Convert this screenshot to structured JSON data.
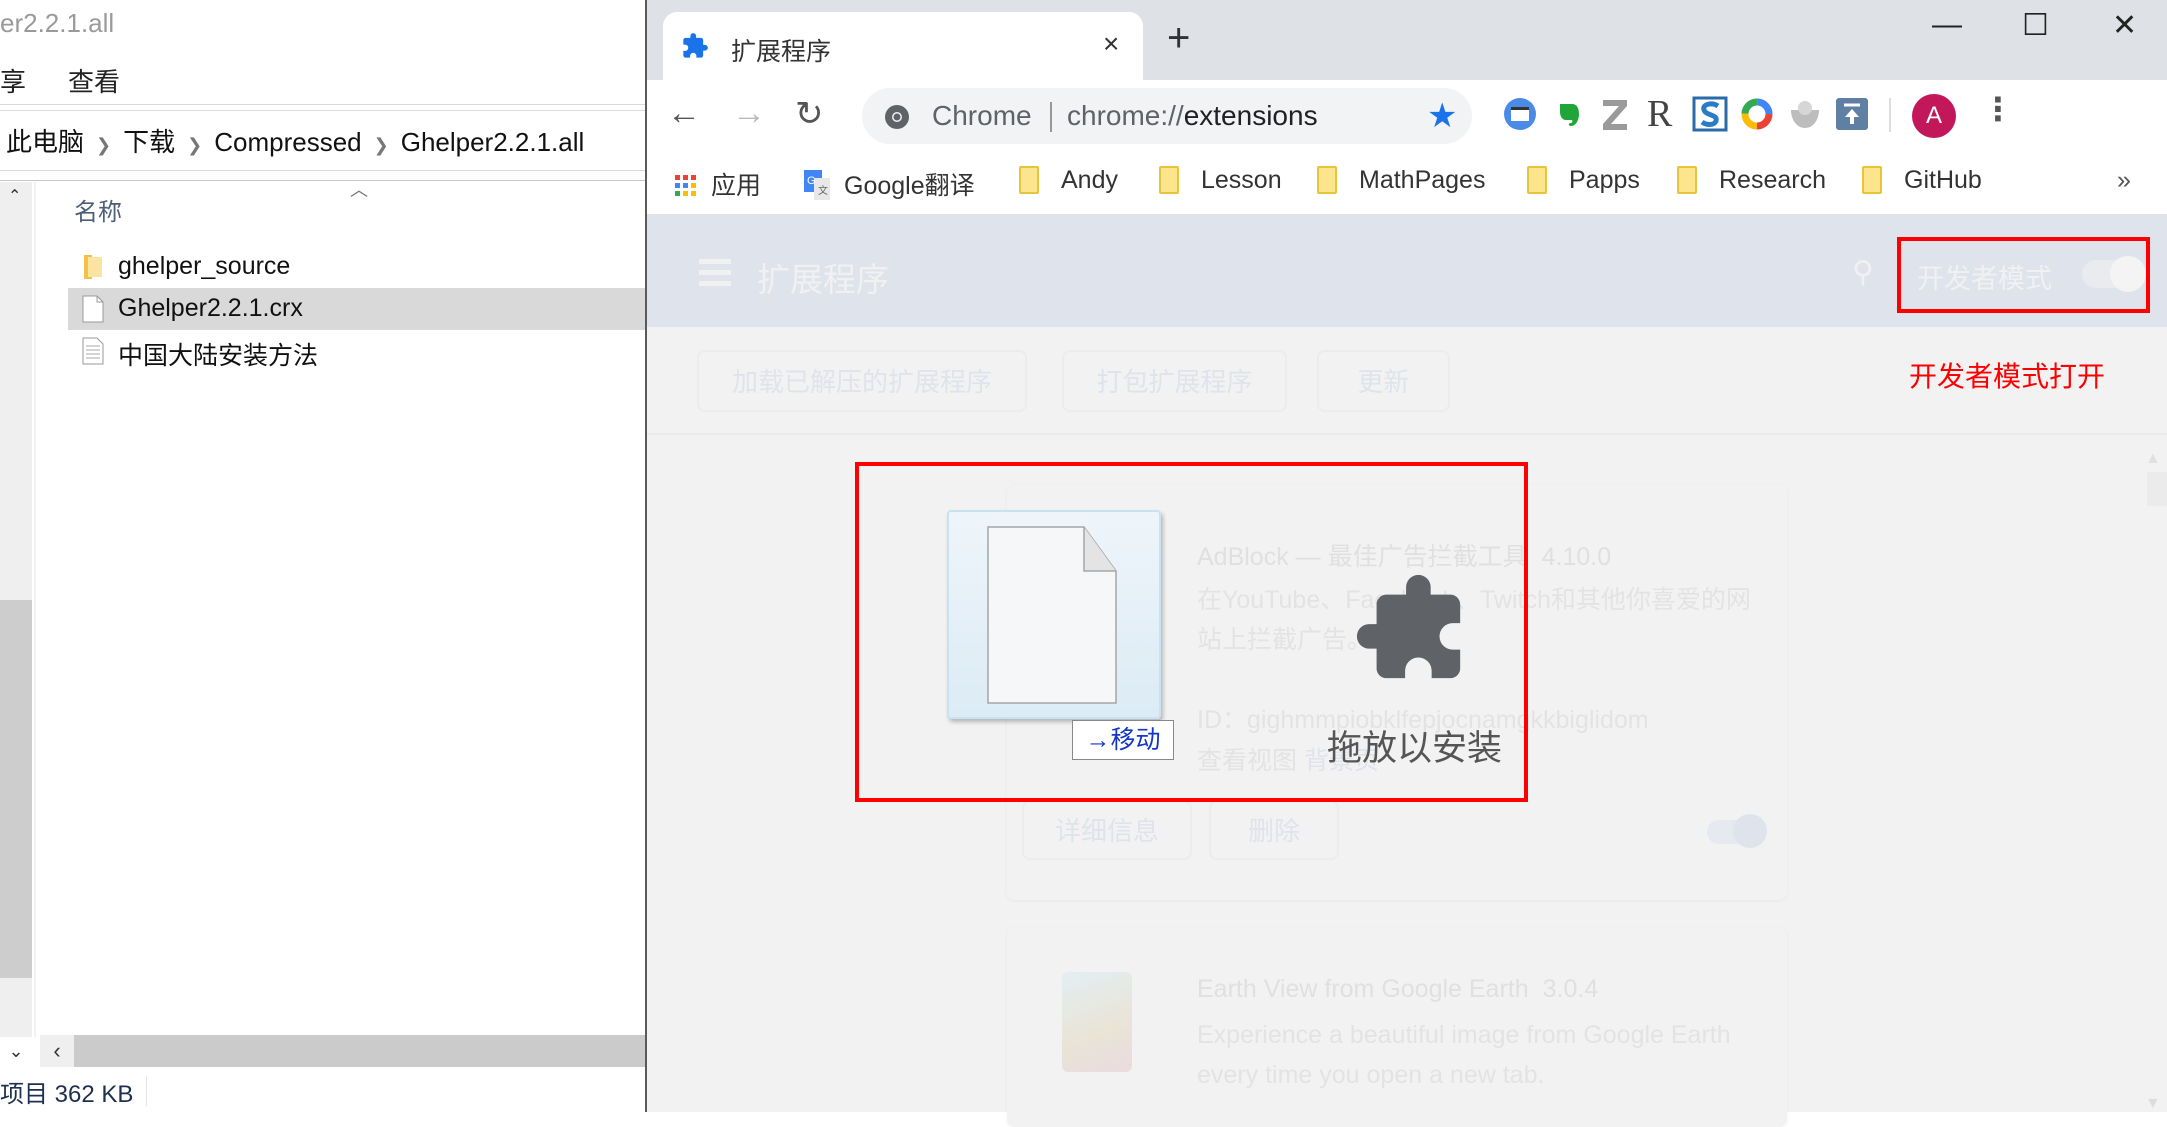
{
  "explorer": {
    "title": "er2.2.1.all",
    "menu": [
      "享",
      "查看"
    ],
    "breadcrumb": [
      "此电脑",
      "下载",
      "Compressed",
      "Ghelper2.2.1.all"
    ],
    "column_header": "名称",
    "files": [
      {
        "name": "ghelper_source",
        "type": "folder",
        "selected": false
      },
      {
        "name": "Ghelper2.2.1.crx",
        "type": "file",
        "selected": true
      },
      {
        "name": "中国大陆安装方法",
        "type": "text",
        "selected": false
      }
    ],
    "status": "项目  362 KB"
  },
  "chrome": {
    "tab_title": "扩展程序",
    "tab_close": "×",
    "new_tab": "+",
    "window_controls": {
      "minimize": "—",
      "maximize": "☐",
      "close": "✕"
    },
    "omnibox": {
      "site_label": "Chrome",
      "url_prefix": "chrome://",
      "url_path": "extensions"
    },
    "extensions": [
      "tab-manager-icon",
      "evernote-icon",
      "zotero-icon",
      "r-icon",
      "s-icon",
      "google-circle-icon",
      "bowl-icon",
      "upload-icon"
    ],
    "profile_initial": "A",
    "bookmarks": [
      {
        "label": "应用",
        "type": "apps"
      },
      {
        "label": "Google翻译",
        "type": "translate"
      },
      {
        "label": "Andy",
        "type": "folder"
      },
      {
        "label": "Lesson",
        "type": "folder"
      },
      {
        "label": "MathPages",
        "type": "folder"
      },
      {
        "label": "Papps",
        "type": "folder"
      },
      {
        "label": "Research",
        "type": "folder"
      },
      {
        "label": "GitHub",
        "type": "folder"
      }
    ],
    "bookmarks_more": "»"
  },
  "extensions_page": {
    "title": "扩展程序",
    "dev_mode_label": "开发者模式",
    "dev_mode_on": true,
    "annotation": "开发者模式打开",
    "toolbar_buttons": [
      "加载已解压的扩展程序",
      "打包扩展程序",
      "更新"
    ],
    "cards": [
      {
        "name": "AdBlock — 最佳广告拦截工具",
        "version": "4.10.0",
        "description": "在YouTube、Facebook、Twitch和其他你喜爱的网站上拦截广告。",
        "id_line": "ID：gighmmpiobklfepjocnamgkkbiglidom",
        "views_label": "查看视图",
        "views_link": "背景页",
        "buttons": [
          "详细信息",
          "删除"
        ],
        "enabled": true
      },
      {
        "name": "Earth View from Google Earth",
        "version": "3.0.4",
        "description": "Experience a beautiful image from Google Earth every time you open a new tab."
      }
    ]
  },
  "drag_overlay": {
    "move_label": "→移动",
    "drop_label": "拖放以安装"
  },
  "colors": {
    "annotation_red": "#ff0000",
    "chrome_blue": "#1a73e8",
    "avatar": "#c2185b",
    "puzzle": "#5f6368"
  }
}
